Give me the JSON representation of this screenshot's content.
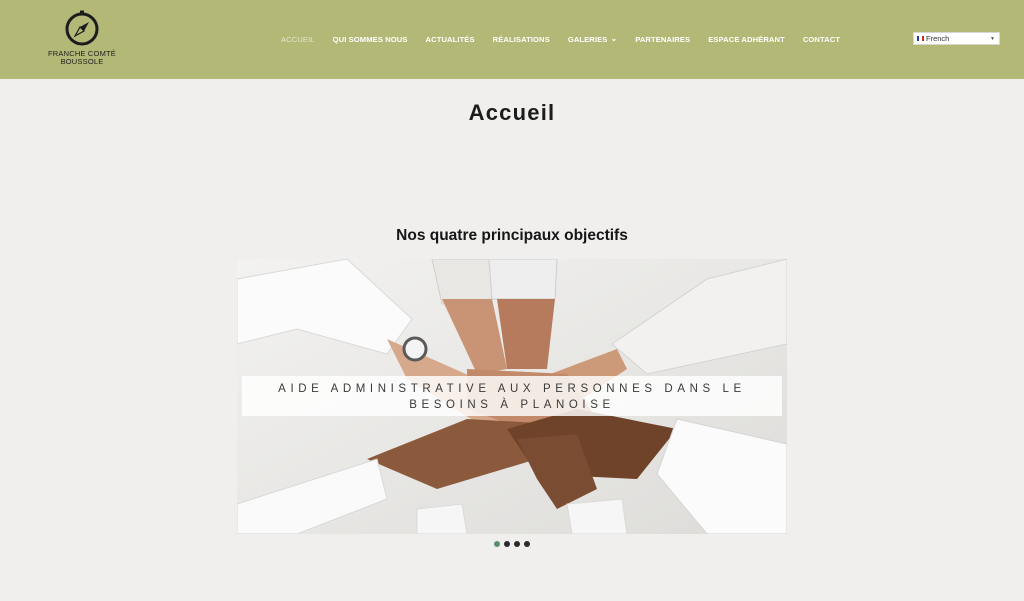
{
  "brand": {
    "logo_icon": "compass-icon",
    "name_line1": "FRANCHE COMTÉ",
    "name_line2": "BOUSSOLE"
  },
  "nav": {
    "items": [
      {
        "label": "ACCUEIL",
        "active": true
      },
      {
        "label": "QUI SOMMES NOUS"
      },
      {
        "label": "ACTUALITÉS"
      },
      {
        "label": "RÉALISATIONS"
      },
      {
        "label": "GALERIES",
        "icon": "chevron-down-icon"
      },
      {
        "label": "PARTENAIRES"
      },
      {
        "label": "ESPACE ADHÉRANT"
      },
      {
        "label": "CONTACT"
      }
    ]
  },
  "language": {
    "selected": "French",
    "flag_icon": "france-flag-icon"
  },
  "page": {
    "title": "Accueil",
    "section_title": "Nos quatre principaux objectifs"
  },
  "slider": {
    "caption_line1": "AIDE ADMINISTRATIVE AUX PERSONNES DANS LE",
    "caption_line2": "BESOINS À PLANOISE",
    "image_description": "hands stacked together",
    "slide_count": 4,
    "active_slide": 1
  },
  "colors": {
    "header_bg": "#b3b877",
    "page_bg": "#f0efee",
    "active_dot": "#5a8f6d"
  }
}
